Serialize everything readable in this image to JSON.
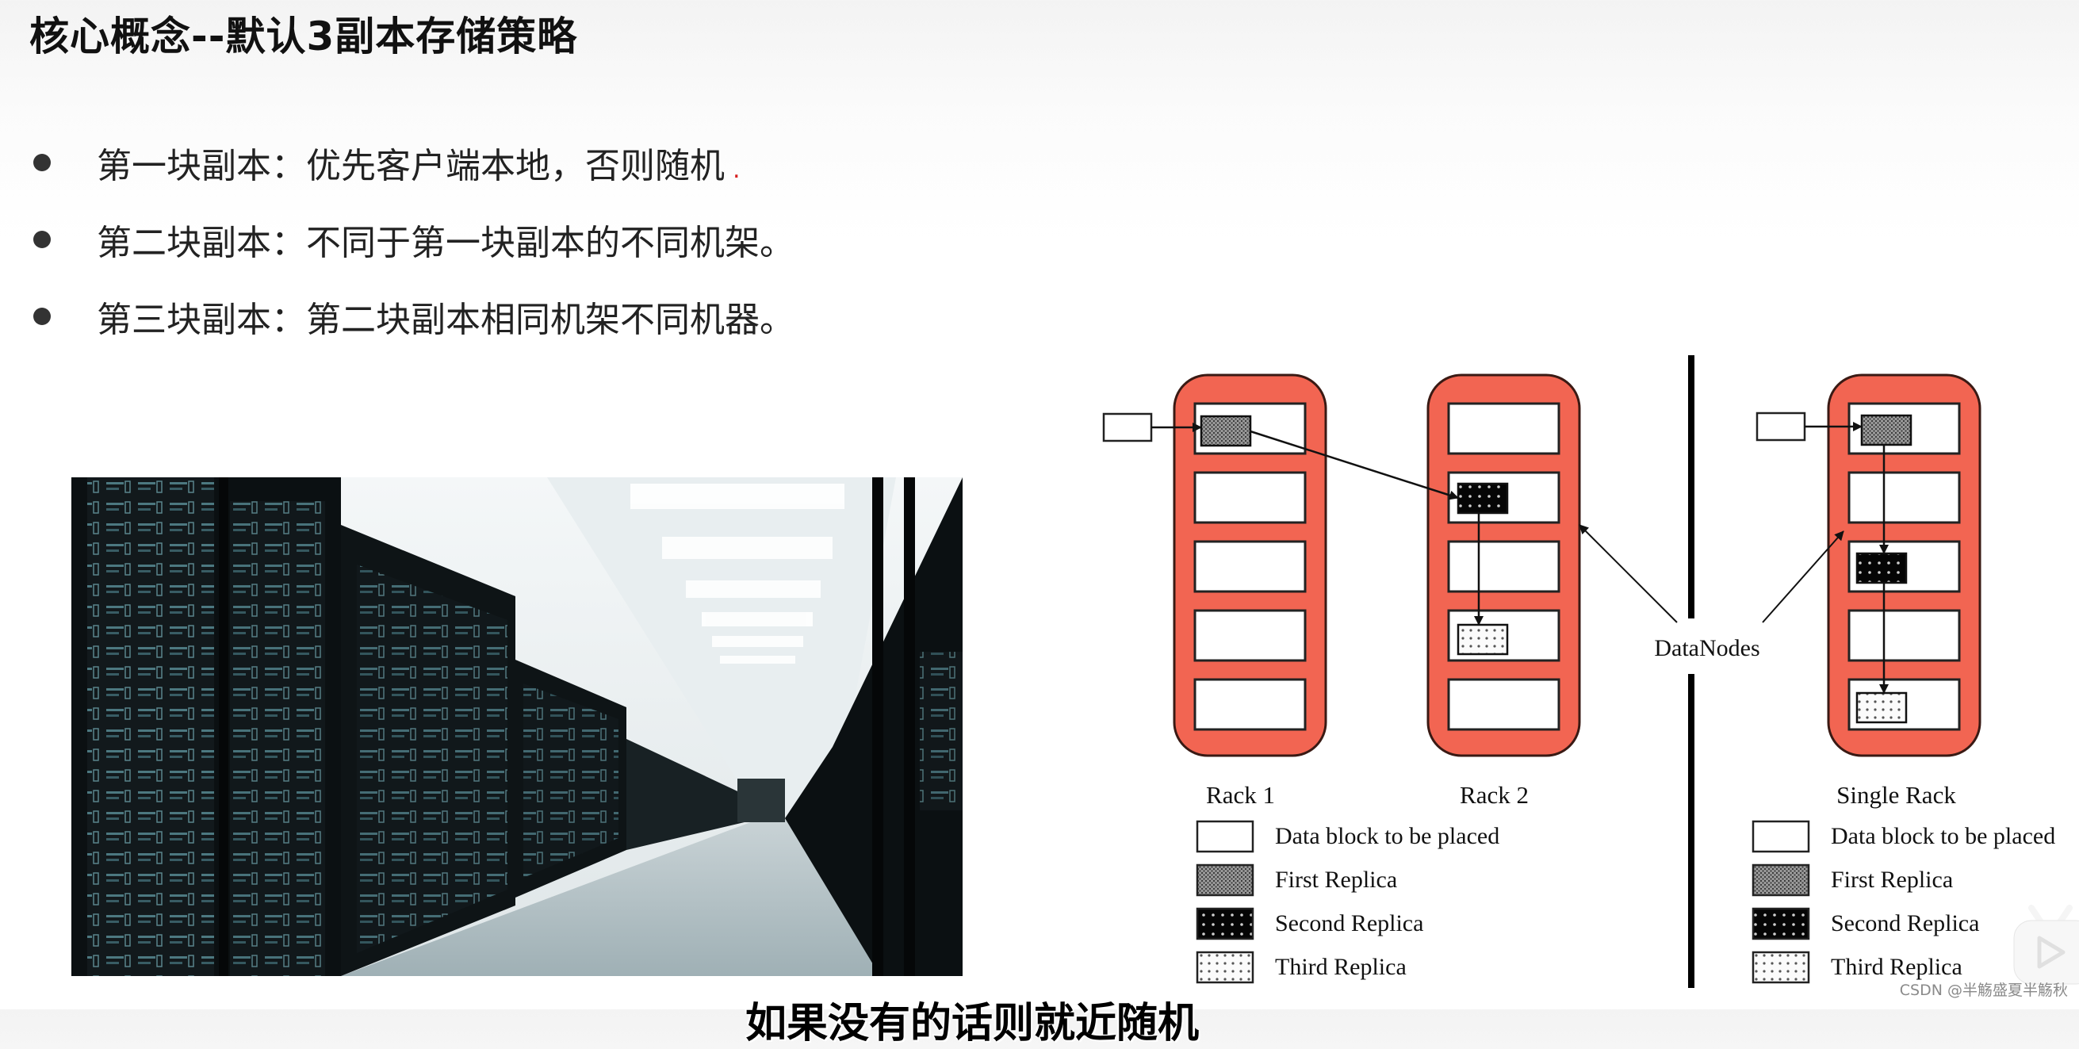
{
  "slide": {
    "title": "核心概念--默认3副本存储策略",
    "bullets": [
      {
        "label": "第一块副本：优先客户端本地，否则随机",
        "suffix_mark": "."
      },
      {
        "label": "第二块副本：不同于第一块副本的不同机架。",
        "suffix_mark": ""
      },
      {
        "label": "第三块副本：第二块副本相同机架不同机器。",
        "suffix_mark": ""
      }
    ],
    "photo": {
      "description": "data-center-server-aisle"
    }
  },
  "diagram": {
    "racks": [
      {
        "label": "Rack 1",
        "slots": 5
      },
      {
        "label": "Rack 2",
        "slots": 5
      },
      {
        "label": "Single Rack",
        "slots": 5
      }
    ],
    "datanodes_label": "DataNodes",
    "legend": [
      {
        "key": "block",
        "label": "Data block to be placed"
      },
      {
        "key": "first",
        "label": "First Replica"
      },
      {
        "key": "second",
        "label": "Second Replica"
      },
      {
        "key": "third",
        "label": "Third Replica"
      }
    ],
    "colors": {
      "rack_fill": "#f26552",
      "rack_stroke": "#3a1a14",
      "slot_fill": "#ffffff",
      "first_replica": "#8a8a8a",
      "second_replica": "#0a0a0a",
      "third_replica": "#f2f2f2"
    }
  },
  "overlay": {
    "subtitle": "如果没有的话则就近随机",
    "watermark": "CSDN @半觞盛夏半觞秋",
    "player_icon": "bilibili-tv-icon"
  }
}
